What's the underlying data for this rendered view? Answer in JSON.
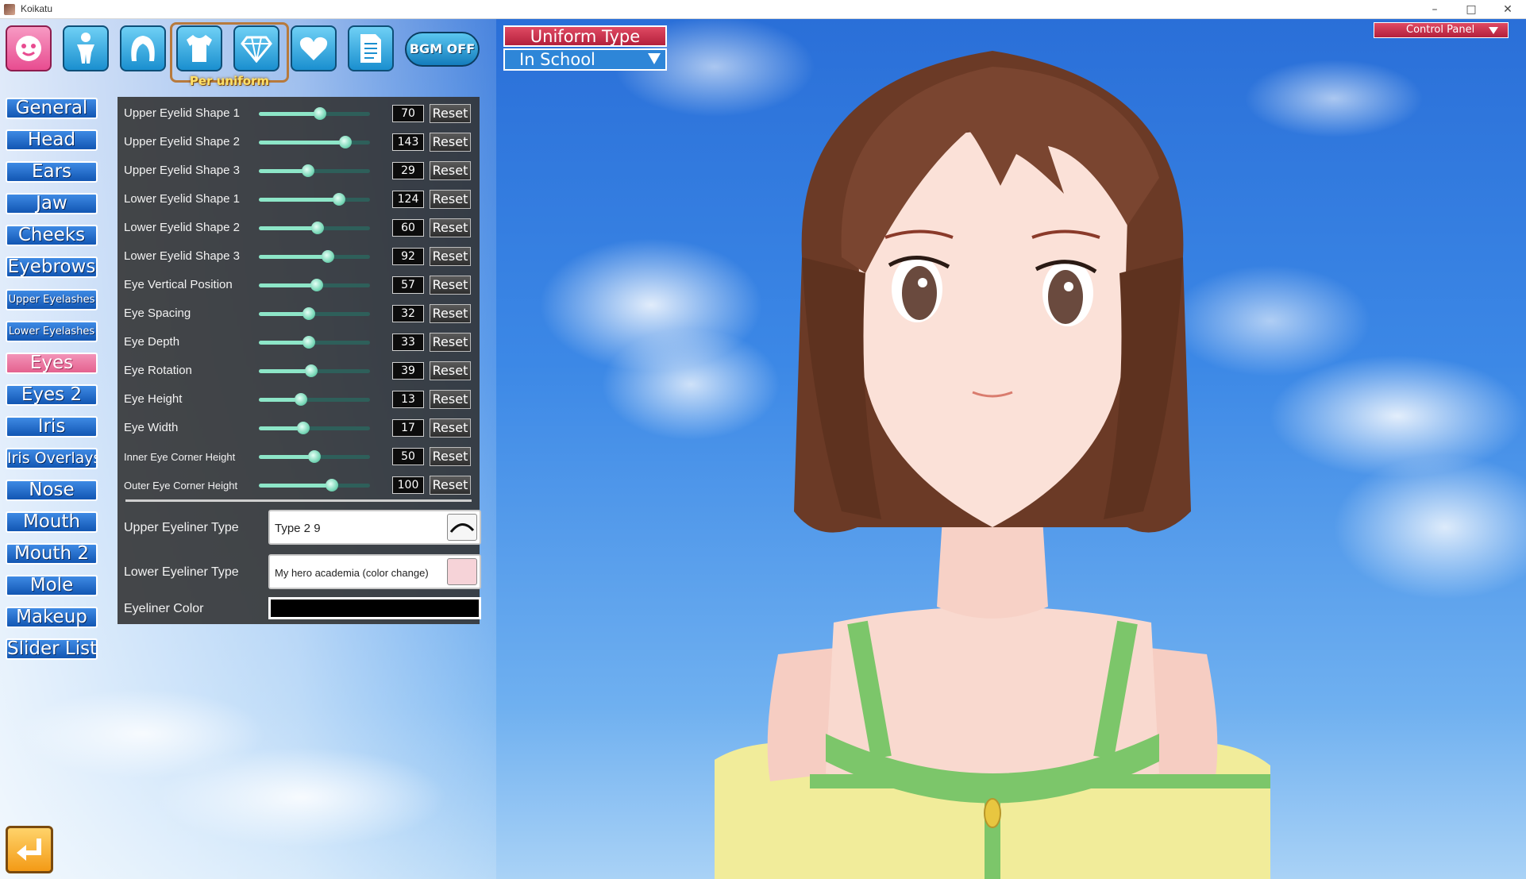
{
  "window": {
    "title": "Koikatu"
  },
  "toolbar": {
    "per_uniform_label": "Per uniform",
    "bgm_label": "BGM OFF"
  },
  "uniform": {
    "title": "Uniform Type",
    "selected": "In School"
  },
  "control_panel": {
    "label": "Control Panel"
  },
  "categories": [
    {
      "label": "General"
    },
    {
      "label": "Head"
    },
    {
      "label": "Ears"
    },
    {
      "label": "Jaw"
    },
    {
      "label": "Cheeks"
    },
    {
      "label": "Eyebrows"
    },
    {
      "label": "Upper Eyelashes"
    },
    {
      "label": "Lower Eyelashes"
    },
    {
      "label": "Eyes"
    },
    {
      "label": "Eyes 2"
    },
    {
      "label": "Iris"
    },
    {
      "label": "Iris Overlays"
    },
    {
      "label": "Nose"
    },
    {
      "label": "Mouth"
    },
    {
      "label": "Mouth 2"
    },
    {
      "label": "Mole"
    },
    {
      "label": "Makeup"
    },
    {
      "label": "Slider List"
    }
  ],
  "active_category": "Eyes",
  "reset_label": "Reset",
  "sliders": [
    {
      "label": "Upper Eyelid Shape 1",
      "value": "70",
      "level": 0.55
    },
    {
      "label": "Upper Eyelid Shape 2",
      "value": "143",
      "level": 0.78
    },
    {
      "label": "Upper Eyelid Shape 3",
      "value": "29",
      "level": 0.44
    },
    {
      "label": "Lower Eyelid Shape 1",
      "value": "124",
      "level": 0.72
    },
    {
      "label": "Lower Eyelid Shape 2",
      "value": "60",
      "level": 0.53
    },
    {
      "label": "Lower Eyelid Shape 3",
      "value": "92",
      "level": 0.62
    },
    {
      "label": "Eye Vertical Position",
      "value": "57",
      "level": 0.52
    },
    {
      "label": "Eye Spacing",
      "value": "32",
      "level": 0.45
    },
    {
      "label": "Eye Depth",
      "value": "33",
      "level": 0.45
    },
    {
      "label": "Eye Rotation",
      "value": "39",
      "level": 0.47
    },
    {
      "label": "Eye Height",
      "value": "13",
      "level": 0.38
    },
    {
      "label": "Eye Width",
      "value": "17",
      "level": 0.4
    },
    {
      "label": "Inner Eye Corner Height",
      "value": "50",
      "level": 0.5
    },
    {
      "label": "Outer Eye Corner Height",
      "value": "100",
      "level": 0.66
    }
  ],
  "eyeliner": {
    "upper_label": "Upper Eyeliner Type",
    "upper_value": "Type 2 9",
    "lower_label": "Lower Eyeliner Type",
    "lower_value": "My hero academia (color change)",
    "color_label": "Eyeliner Color",
    "color_value": "#000000"
  },
  "colors": {
    "accent_red": "#c02a45",
    "panel_bg": "#303030",
    "slider_fill": "#8de6c8",
    "category_blue": "#2a72d0",
    "category_active": "#e87aa3"
  },
  "icons": [
    "face-icon",
    "body-icon",
    "hair-icon",
    "clothes-icon",
    "accessory-icon",
    "heart-icon",
    "document-icon",
    "back-icon"
  ]
}
